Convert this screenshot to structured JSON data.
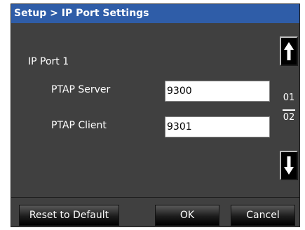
{
  "window": {
    "title": "Setup > IP Port Settings"
  },
  "section": {
    "label": "IP Port 1"
  },
  "fields": [
    {
      "label": "PTAP Server",
      "value": "9300"
    },
    {
      "label": "PTAP Client",
      "value": "9301"
    }
  ],
  "pager": {
    "current": "01",
    "total": "02"
  },
  "buttons": {
    "reset": "Reset to Default",
    "ok": "OK",
    "cancel": "Cancel"
  },
  "colors": {
    "titlebar": "#2f5da8",
    "panel": "#404040"
  }
}
